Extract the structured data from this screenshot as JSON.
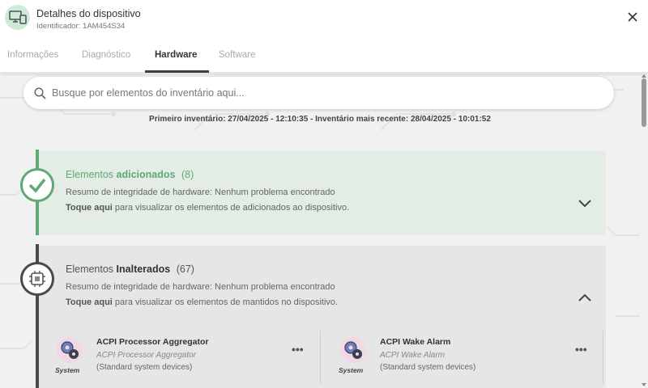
{
  "header": {
    "title": "Detalhes do dispositivo",
    "subtitle": "Identificador: 1AM454S34",
    "device_icon": "monitor-laptop-icon",
    "close_icon": "close-icon"
  },
  "tabs": [
    {
      "label": "Informações",
      "active": false
    },
    {
      "label": "Diagnóstico",
      "active": false
    },
    {
      "label": "Hardware",
      "active": true
    },
    {
      "label": "Software",
      "active": false
    }
  ],
  "search": {
    "placeholder": "Busque por elementos do inventário aqui...",
    "value": ""
  },
  "inventory": {
    "text": "Primeiro inventário: 27/04/2025 - 12:10:35 - Inventário mais recente: 28/04/2025 - 10:01:52"
  },
  "sections": {
    "added": {
      "title_prefix": "Elementos ",
      "title_bold": "adicionados",
      "count": "(8)",
      "summary": "Resumo de integridade de hardware: Nenhum problema encontrado",
      "tap_bold": "Toque aqui",
      "tap_rest": " para visualizar os elementos de adicionados ao dispositivo.",
      "color": "#5fa877",
      "expanded": false
    },
    "unchanged": {
      "title_prefix": "Elementos ",
      "title_bold": "Inalterados",
      "count": "(67)",
      "summary": "Resumo de integridade de hardware: Nenhum problema encontrado",
      "tap_bold": "Toque aqui",
      "tap_rest": " para visualizar os elementos de mantidos no dispositivo.",
      "color": "#4a4a4a",
      "expanded": true
    }
  },
  "items": [
    {
      "name": "ACPI Processor Aggregator",
      "description": "ACPI Processor Aggregator",
      "category": "(Standard system devices)",
      "type_label": "System",
      "more": "•••"
    },
    {
      "name": "ACPI Wake Alarm",
      "description": "ACPI Wake Alarm",
      "category": "(Standard system devices)",
      "type_label": "System",
      "more": "•••"
    }
  ],
  "colors": {
    "accent_dark": "#3a3f4a",
    "green": "#5fa877",
    "green_bg": "#e3ece5",
    "gray_bg": "#e6e6e6"
  }
}
